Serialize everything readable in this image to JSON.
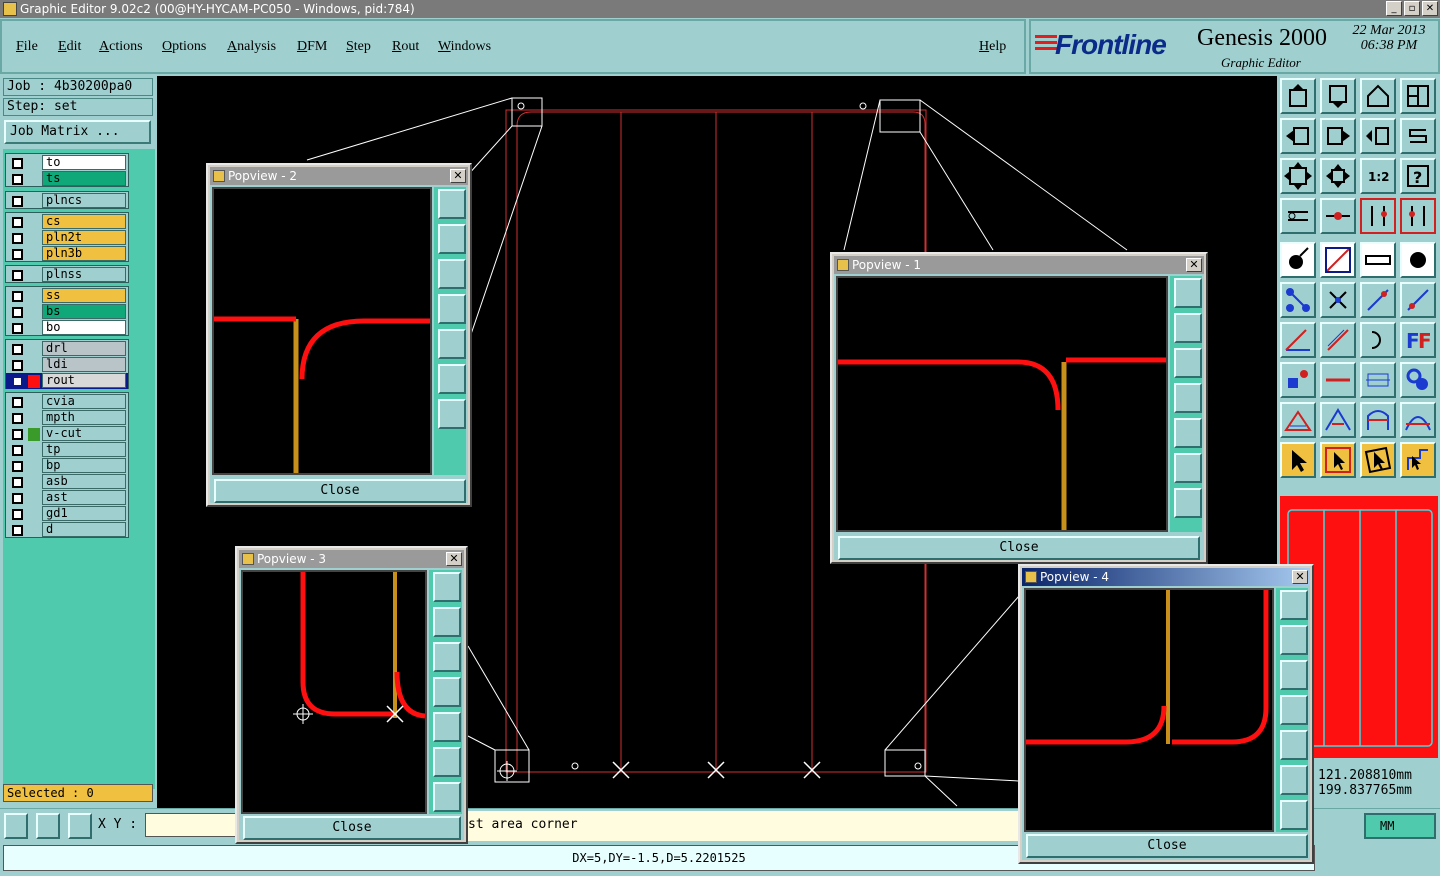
{
  "window": {
    "title": "Graphic Editor 9.02c2 (00@HY-HYCAM-PC050 - Windows, pid:784)",
    "controls": [
      "_",
      "▫",
      "✕"
    ]
  },
  "menu": [
    "File",
    "Edit",
    "Actions",
    "Options",
    "Analysis",
    "DFM",
    "Step",
    "Rout",
    "Windows",
    "Help"
  ],
  "brand": {
    "logo": "Frontline",
    "product": "Genesis 2000",
    "subtitle": "Graphic Editor",
    "date": "22 Mar 2013",
    "time": "06:38 PM"
  },
  "job": {
    "job_label": "Job : 4b30200pa0",
    "step_label": "Step: set",
    "matrix_button": "Job Matrix ..."
  },
  "layers": [
    {
      "name": "to",
      "color": "#ffffff"
    },
    {
      "name": "ts",
      "color": "#10a878"
    },
    {
      "name": "plncs",
      "color": "#9fd0cf"
    },
    {
      "name": "cs",
      "color": "#f0c040"
    },
    {
      "name": "pln2t",
      "color": "#f0c040"
    },
    {
      "name": "pln3b",
      "color": "#f0c040"
    },
    {
      "name": "plnss",
      "color": "#9fd0cf"
    },
    {
      "name": "ss",
      "color": "#f0c040"
    },
    {
      "name": "bs",
      "color": "#10a878"
    },
    {
      "name": "bo",
      "color": "#ffffff"
    },
    {
      "name": "drl",
      "color": "#b8c4c8"
    },
    {
      "name": "ldi",
      "color": "#b8c4c8"
    },
    {
      "name": "rout",
      "color": "#d8d8d8"
    },
    {
      "name": "cvia",
      "color": "#9fd0cf"
    },
    {
      "name": "mpth",
      "color": "#9fd0cf"
    },
    {
      "name": "v-cut",
      "color": "#9fd0cf"
    },
    {
      "name": "tp",
      "color": "#9fd0cf"
    },
    {
      "name": "bp",
      "color": "#9fd0cf"
    },
    {
      "name": "asb",
      "color": "#9fd0cf"
    },
    {
      "name": "ast",
      "color": "#9fd0cf"
    },
    {
      "name": "gd1",
      "color": "#9fd0cf"
    },
    {
      "name": "d",
      "color": "#9fd0cf"
    }
  ],
  "selected": "Selected : 0",
  "coords": {
    "x": "121.208810mm",
    "y": "199.837765mm"
  },
  "bottom": {
    "xy_label": "X Y :",
    "xy_value": "",
    "message": "st area corner",
    "units": "MM"
  },
  "status": "DX=5,DY=-1.5,D=5.2201525",
  "popviews": {
    "p1": {
      "title": "Popview - 1",
      "close": "Close"
    },
    "p2": {
      "title": "Popview - 2",
      "close": "Close"
    },
    "p3": {
      "title": "Popview - 3",
      "close": "Close"
    },
    "p4": {
      "title": "Popview - 4",
      "close": "Close"
    }
  },
  "colors": {
    "rout": "#ff1010",
    "board_outline": "#d03030",
    "vcut": "#c8901a",
    "panel": "#9fd0cf",
    "accent": "#4fcaad"
  }
}
